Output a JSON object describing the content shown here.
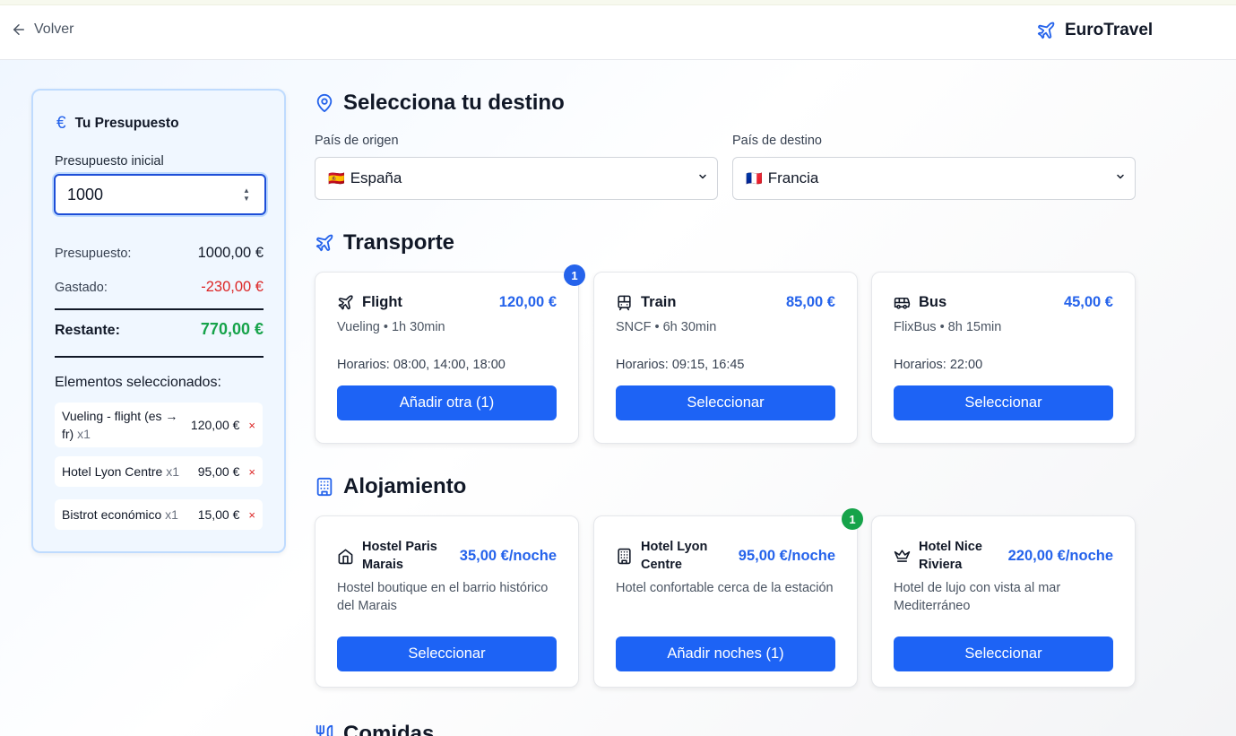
{
  "header": {
    "back_label": "Volver",
    "brand": "EuroTravel"
  },
  "sidebar": {
    "title": "Tu Presupuesto",
    "currency_symbol": "€",
    "initial_label": "Presupuesto inicial",
    "initial_value": "1000",
    "budget_label": "Presupuesto:",
    "budget_value": "1000,00 €",
    "spent_label": "Gastado:",
    "spent_value": "-230,00 €",
    "remaining_label": "Restante:",
    "remaining_value": "770,00 €",
    "selected_title": "Elementos seleccionados:",
    "selected_items": [
      {
        "name": "Vueling - flight (es → fr)",
        "qty": "x1",
        "price": "120,00 €",
        "remove": "×"
      },
      {
        "name": "Hotel Lyon Centre",
        "qty": "x1",
        "price": "95,00 €",
        "remove": "×"
      },
      {
        "name": "Bistrot económico",
        "qty": "x1",
        "price": "15,00 €",
        "remove": "×"
      }
    ]
  },
  "destination": {
    "title": "Selecciona tu destino",
    "origin_label": "País de origen",
    "origin_flag": "🇪🇸",
    "origin_value": "España",
    "dest_label": "País de destino",
    "dest_flag": "🇫🇷",
    "dest_value": "Francia"
  },
  "transport": {
    "title": "Transporte",
    "options": [
      {
        "name": "Flight",
        "icon": "plane-icon",
        "price": "120,00 €",
        "sub": "Vueling • 1h 30min",
        "schedule": "Horarios: 08:00, 14:00, 18:00",
        "button": "Añadir otra (1)",
        "badge": "1"
      },
      {
        "name": "Train",
        "icon": "train-icon",
        "price": "85,00 €",
        "sub": "SNCF • 6h 30min",
        "schedule": "Horarios: 09:15, 16:45",
        "button": "Seleccionar"
      },
      {
        "name": "Bus",
        "icon": "bus-icon",
        "price": "45,00 €",
        "sub": "FlixBus • 8h 15min",
        "schedule": "Horarios: 22:00",
        "button": "Seleccionar"
      }
    ]
  },
  "lodging": {
    "title": "Alojamiento",
    "options": [
      {
        "name_line1": "Hostel Paris",
        "name_line2": "Marais",
        "icon": "home-icon",
        "price": "35,00 €/noche",
        "desc": "Hostel boutique en el barrio histórico del Marais",
        "button": "Seleccionar"
      },
      {
        "name_line1": "Hotel Lyon",
        "name_line2": "Centre",
        "icon": "building-icon",
        "price": "95,00 €/noche",
        "desc": "Hotel confortable cerca de la estación",
        "button": "Añadir noches (1)",
        "badge": "1"
      },
      {
        "name_line1": "Hotel Nice",
        "name_line2": "Riviera",
        "icon": "crown-icon",
        "price": "220,00 €/noche",
        "desc": "Hotel de lujo con vista al mar Mediterráneo",
        "button": "Seleccionar"
      }
    ]
  },
  "meals": {
    "title": "Comidas"
  },
  "colors": {
    "accent": "#2563eb",
    "button": "#1d63f5",
    "success": "#16a34a",
    "danger": "#dc2626"
  }
}
